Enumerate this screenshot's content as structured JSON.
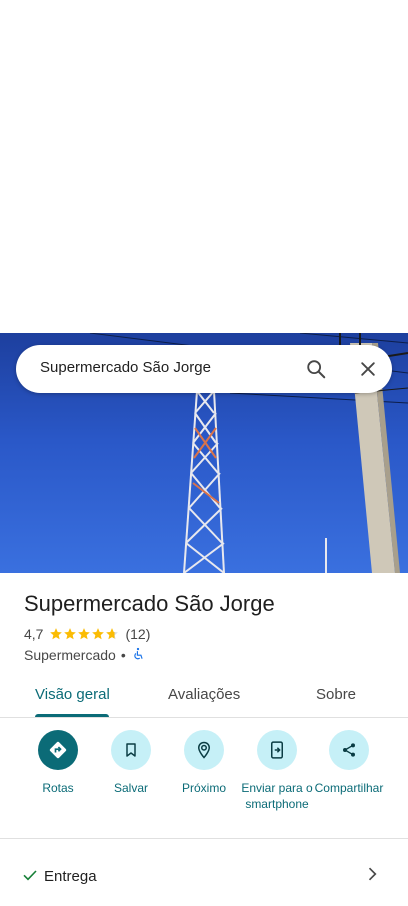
{
  "search": {
    "query": "Supermercado São Jorge"
  },
  "place": {
    "name": "Supermercado São Jorge",
    "rating": "4,7",
    "rating_value": 4.7,
    "review_count": "(12)",
    "category": "Supermercado",
    "separator": "•"
  },
  "tabs": [
    {
      "label": "Visão geral",
      "active": true
    },
    {
      "label": "Avaliações",
      "active": false
    },
    {
      "label": "Sobre",
      "active": false
    }
  ],
  "actions": [
    {
      "label": "Rotas",
      "icon": "directions-icon"
    },
    {
      "label": "Salvar",
      "icon": "bookmark-icon"
    },
    {
      "label": "Próximo",
      "icon": "nearby-icon"
    },
    {
      "label": "Enviar para o smartphone",
      "icon": "send-to-phone-icon"
    },
    {
      "label": "Compartilhar",
      "icon": "share-icon"
    }
  ],
  "attributes": [
    {
      "label": "Entrega",
      "icon": "check-icon"
    }
  ],
  "colors": {
    "accent": "#0b6b77",
    "action_bg": "#c6f0f7",
    "star": "#fbbc04"
  }
}
